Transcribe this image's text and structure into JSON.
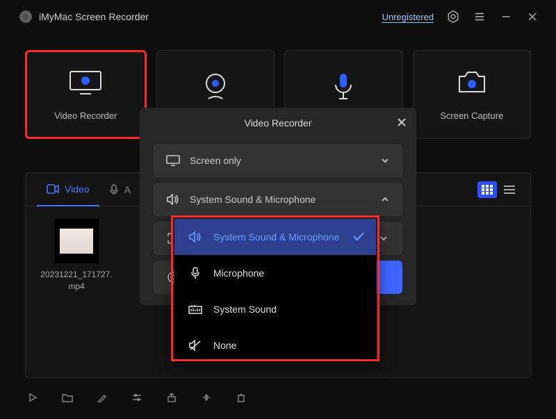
{
  "app": {
    "title": "iMyMac Screen Recorder",
    "unregistered_label": "Unregistered"
  },
  "modes": {
    "video_recorder": "Video Recorder",
    "webcam_recorder": "",
    "audio_recorder": "",
    "screen_capture": "Screen Capture"
  },
  "tabs": {
    "video": "Video",
    "audio_prefix": "A"
  },
  "file": {
    "name": "20231221_171727.mp4"
  },
  "modal": {
    "title": "Video Recorder",
    "screen_mode": "Screen only",
    "audio_mode": "System Sound & Microphone",
    "options": {
      "system_mic": "System Sound & Microphone",
      "microphone": "Microphone",
      "system_sound": "System Sound",
      "none": "None"
    }
  }
}
